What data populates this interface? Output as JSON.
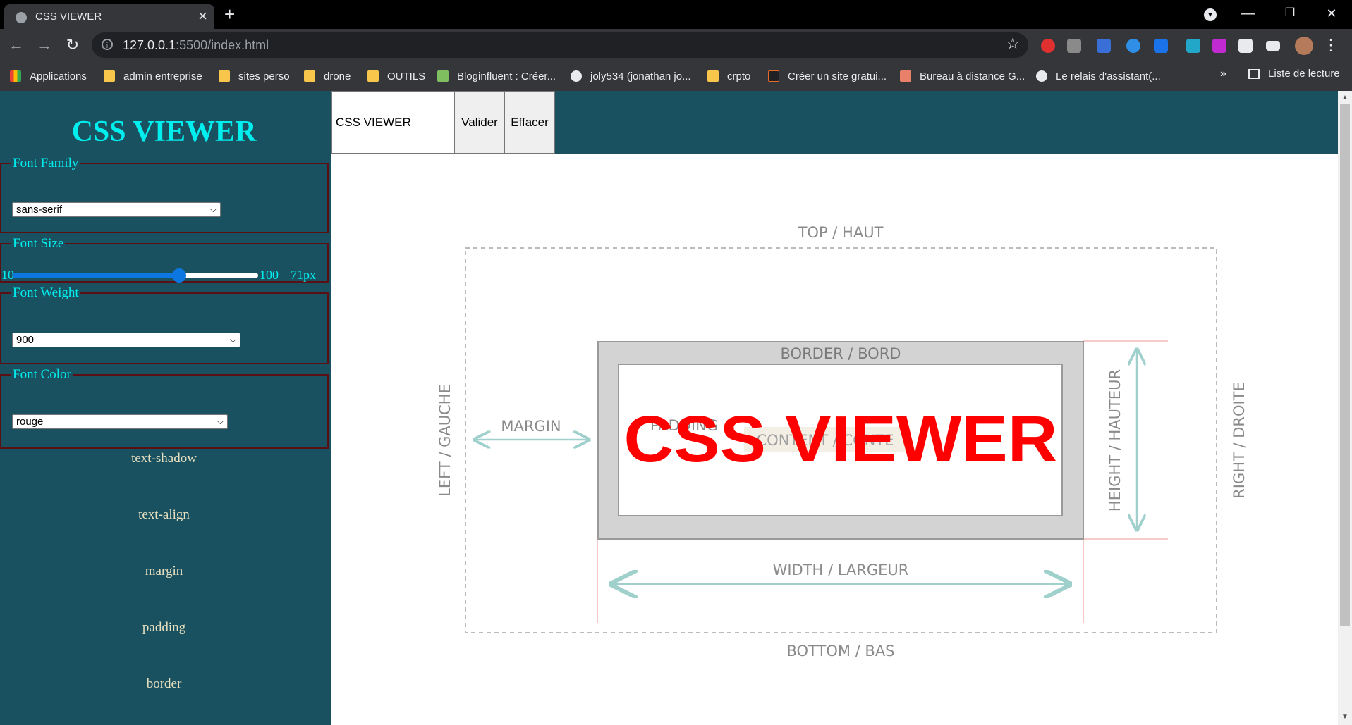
{
  "browser": {
    "tab_title": "CSS VIEWER",
    "url_host": "127.0.0.1",
    "url_rest": ":5500/index.html",
    "window_buttons": [
      "—",
      "❐",
      "✕"
    ],
    "bookmarks": [
      {
        "label": "Applications",
        "icon": "apps-grid-icon"
      },
      {
        "label": "admin entreprise",
        "icon": "folder-icon"
      },
      {
        "label": "sites perso",
        "icon": "folder-icon"
      },
      {
        "label": "drone",
        "icon": "folder-icon"
      },
      {
        "label": "OUTILS",
        "icon": "folder-icon"
      },
      {
        "label": "Bloginfluent : Créer...",
        "icon": "bloginfluent-icon"
      },
      {
        "label": "joly534 (jonathan jo...",
        "icon": "github-icon"
      },
      {
        "label": "crpto",
        "icon": "folder-icon"
      },
      {
        "label": "Créer un site gratui...",
        "icon": "site-builder-icon"
      },
      {
        "label": "Bureau à distance G...",
        "icon": "remote-desktop-icon"
      },
      {
        "label": "Le relais d'assistant(...",
        "icon": "globe-icon"
      }
    ],
    "bookmarks_more": "»",
    "reading_list": "Liste de lecture"
  },
  "sidebar": {
    "title": "CSS VIEWER",
    "font_family": {
      "legend": "Font Family",
      "value": "sans-serif"
    },
    "font_size": {
      "legend": "Font Size",
      "min": "10",
      "max": "100",
      "value": 71,
      "display": "71px"
    },
    "font_weight": {
      "legend": "Font Weight",
      "value": "900"
    },
    "font_color": {
      "legend": "Font Color",
      "value": "rouge"
    },
    "links": [
      "text-shadow",
      "text-align",
      "margin",
      "padding",
      "border"
    ]
  },
  "topbar": {
    "input_value": "CSS VIEWER",
    "validate_label": "Valider",
    "clear_label": "Effacer"
  },
  "diagram": {
    "top": "TOP / HAUT",
    "bottom": "BOTTOM / BAS",
    "left": "LEFT / GAUCHE",
    "right": "RIGHT / DROITE",
    "border": "BORDER / BORD",
    "margin": "MARGIN",
    "padding": "PADDING",
    "content": "CONTENT / CONTE",
    "height": "HEIGHT / HAUTEUR",
    "width": "WIDTH / LARGEUR"
  },
  "preview": {
    "text": "CSS VIEWER",
    "color": "#ff0000"
  },
  "colors": {
    "sidebar_bg": "#1a5160",
    "accent_cyan": "#00eeee",
    "fieldset_border": "#5a0f14",
    "slider_blue": "#0c77e0"
  }
}
